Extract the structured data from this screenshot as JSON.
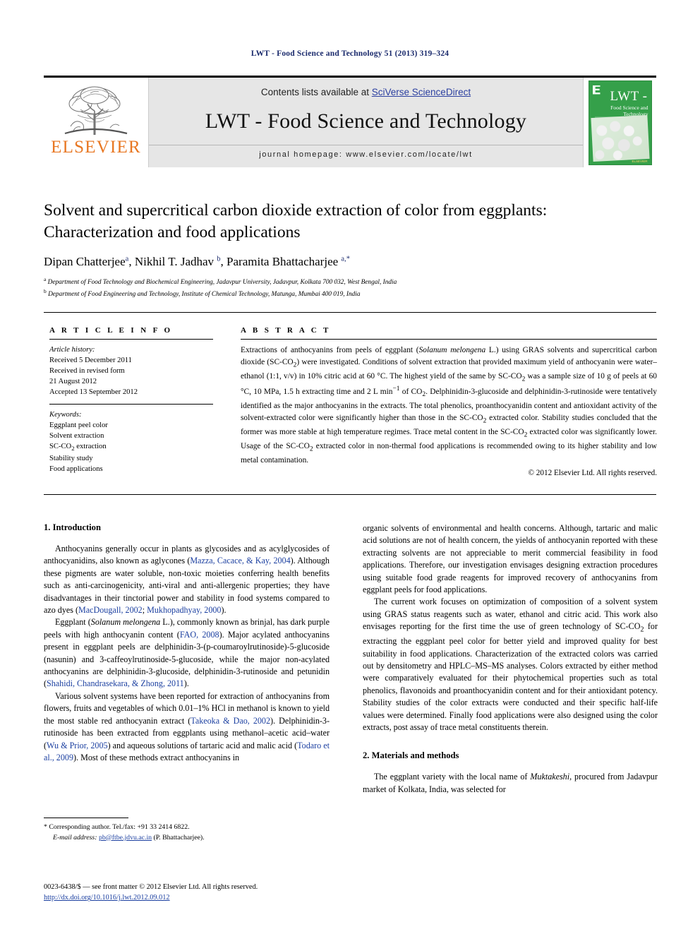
{
  "running_head": "LWT - Food Science and Technology 51 (2013) 319–324",
  "journal_header": {
    "contents_prefix": "Contents lists available at ",
    "contents_link": "SciVerse ScienceDirect",
    "journal_title": "LWT - Food Science and Technology",
    "homepage": "journal homepage: www.elsevier.com/locate/lwt",
    "publisher_logo_text": "ELSEVIER",
    "cover": {
      "line1": "LWT -",
      "line2": "Food Science and Technology",
      "footer": "ELSEVIER"
    }
  },
  "article": {
    "title": "Solvent and supercritical carbon dioxide extraction of color from eggplants: Characterization and food applications",
    "authors_html": "Dipan Chatterjee<sup>a</sup>, Nikhil T. Jadhav <sup>b</sup>, Paramita Bhattacharjee <sup>a,*</sup>",
    "affiliation_a": "Department of Food Technology and Biochemical Engineering, Jadavpur University, Jadavpur, Kolkata 700 032, West Bengal, India",
    "affiliation_b": "Department of Food Engineering and Technology, Institute of Chemical Technology, Matunga, Mumbai 400 019, India"
  },
  "article_info": {
    "heading": "A R T I C L E   I N F O",
    "history_label": "Article history:",
    "history": [
      "Received 5 December 2011",
      "Received in revised form",
      "21 August 2012",
      "Accepted 13 September 2012"
    ],
    "keywords_label": "Keywords:",
    "keywords": [
      "Eggplant peel color",
      "Solvent extraction",
      "SC-CO2 extraction",
      "Stability study",
      "Food applications"
    ]
  },
  "abstract": {
    "heading": "A B S T R A C T",
    "text": "Extractions of anthocyanins from peels of eggplant (Solanum melongena L.) using GRAS solvents and supercritical carbon dioxide (SC-CO2) were investigated. Conditions of solvent extraction that provided maximum yield of anthocyanin were water–ethanol (1:1, v/v) in 10% citric acid at 60 °C. The highest yield of the same by SC-CO2 was a sample size of 10 g of peels at 60 °C, 10 MPa, 1.5 h extracting time and 2 L min−1 of CO2. Delphinidin-3-glucoside and delphinidin-3-rutinoside were tentatively identified as the major anthocyanins in the extracts. The total phenolics, proanthocyanidin content and antioxidant activity of the solvent-extracted color were significantly higher than those in the SC-CO2 extracted color. Stability studies concluded that the former was more stable at high temperature regimes. Trace metal content in the SC-CO2 extracted color was significantly lower. Usage of the SC-CO2 extracted color in non-thermal food applications is recommended owing to its higher stability and low metal contamination.",
    "copyright": "© 2012 Elsevier Ltd. All rights reserved."
  },
  "body": {
    "intro_heading": "1. Introduction",
    "methods_heading": "2. Materials and methods",
    "left_paragraphs": [
      "Anthocyanins generally occur in plants as glycosides and as acylglycosides of anthocyanidins, also known as aglycones (Mazza, Cacace, & Kay, 2004). Although these pigments are water soluble, non-toxic moieties conferring health benefits such as anti-carcinogenicity, anti-viral and anti-allergenic properties; they have disadvantages in their tinctorial power and stability in food systems compared to azo dyes (MacDougall, 2002; Mukhopadhyay, 2000).",
      "Eggplant (Solanum melongena L.), commonly known as brinjal, has dark purple peels with high anthocyanin content (FAO, 2008). Major acylated anthocyanins present in eggplant peels are delphinidin-3-(p-coumaroylrutinoside)-5-glucoside (nasunin) and 3-caffeoylrutinoside-5-glucoside, while the major non-acylated anthocyanins are delphinidin-3-glucoside, delphinidin-3-rutinoside and petunidin (Shahidi, Chandrasekara, & Zhong, 2011).",
      "Various solvent systems have been reported for extraction of anthocyanins from flowers, fruits and vegetables of which 0.01–1% HCl in methanol is known to yield the most stable red anthocyanin extract (Takeoka & Dao, 2002). Delphinidin-3-rutinoside has been extracted from eggplants using methanol–acetic acid–water (Wu & Prior, 2005) and aqueous solutions of tartaric acid and malic acid (Todaro et al., 2009). Most of these methods extract anthocyanins in"
    ],
    "right_paragraphs": [
      "organic solvents of environmental and health concerns. Although, tartaric and malic acid solutions are not of health concern, the yields of anthocyanin reported with these extracting solvents are not appreciable to merit commercial feasibility in food applications. Therefore, our investigation envisages designing extraction procedures using suitable food grade reagents for improved recovery of anthocyanins from eggplant peels for food applications.",
      "The current work focuses on optimization of composition of a solvent system using GRAS status reagents such as water, ethanol and citric acid. This work also envisages reporting for the first time the use of green technology of SC-CO2 for extracting the eggplant peel color for better yield and improved quality for best suitability in food applications. Characterization of the extracted colors was carried out by densitometry and HPLC–MS–MS analyses. Colors extracted by either method were comparatively evaluated for their phytochemical properties such as total phenolics, flavonoids and proanthocyanidin content and for their antioxidant potency. Stability studies of the color extracts were conducted and their specific half-life values were determined. Finally food applications were also designed using the color extracts, post assay of trace metal constituents therein.",
      "The eggplant variety with the local name of Muktakeshi, procured from Jadavpur market of Kolkata, India, was selected for"
    ]
  },
  "footnote": {
    "corresponding": "* Corresponding author. Tel./fax: +91 33 2414 6822.",
    "email_label": "E-mail address:",
    "email": "pb@ftbe.jdvu.ac.in",
    "email_suffix": "(P. Bhattacharjee)."
  },
  "footer": {
    "issn_line": "0023-6438/$ — see front matter © 2012 Elsevier Ltd. All rights reserved.",
    "doi": "http://dx.doi.org/10.1016/j.lwt.2012.09.012"
  },
  "colors": {
    "link_blue": "#1b3fa0",
    "elsevier_orange": "#E87722",
    "cover_green": "#35a04a",
    "header_gray": "#e6e6e6"
  }
}
